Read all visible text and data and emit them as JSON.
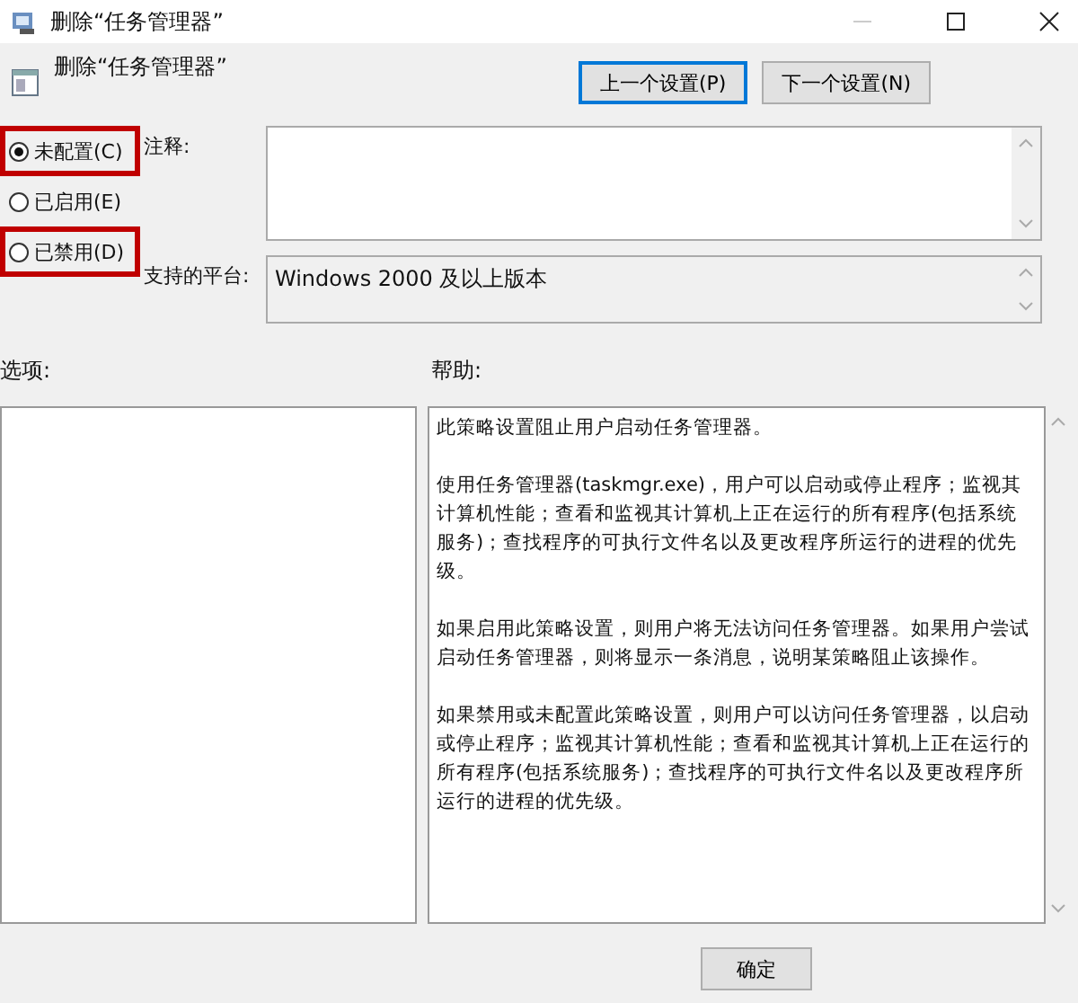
{
  "window": {
    "title": "删除“任务管理器”"
  },
  "header": {
    "title": "删除“任务管理器”",
    "buttons": [
      {
        "label": "上一个设置(P)",
        "focused": true
      },
      {
        "label": "下一个设置(N)",
        "focused": false
      }
    ]
  },
  "options": [
    {
      "label": "未配置(C)",
      "selected": true,
      "highlighted": true
    },
    {
      "label": "已启用(E)",
      "selected": false,
      "highlighted": false
    },
    {
      "label": "已禁用(D)",
      "selected": false,
      "highlighted": true
    }
  ],
  "comment": {
    "label": "注释:"
  },
  "platform": {
    "label": "支持的平台:",
    "value": "Windows 2000 及以上版本"
  },
  "options_panel": {
    "label": "选项:"
  },
  "help": {
    "label": "帮助:",
    "paragraphs": [
      "此策略设置阻止用户启动任务管理器。",
      "使用任务管理器(taskmgr.exe)，用户可以启动或停止程序；监视其计算机性能；查看和监视其计算机上正在运行的所有程序(包括系统服务)；查找程序的可执行文件名以及更改程序所运行的进程的优先级。",
      "如果启用此策略设置，则用户将无法访问任务管理器。如果用户尝试启动任务管理器，则将显示一条消息，说明某策略阻止该操作。",
      "如果禁用或未配置此策略设置，则用户可以访问任务管理器，以启动或停止程序；监视其计算机性能；查看和监视其计算机上正在运行的所有程序(包括系统服务)；查找程序的可执行文件名以及更改程序所运行的进程的优先级。"
    ]
  },
  "footer": {
    "buttons": [
      "确定"
    ]
  }
}
